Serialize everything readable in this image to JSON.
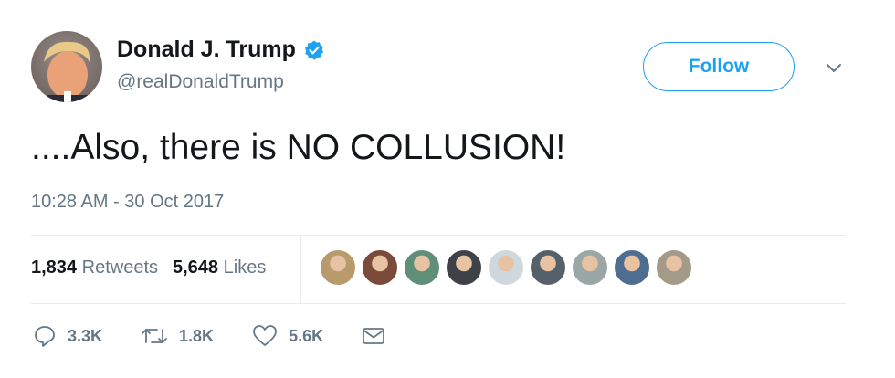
{
  "author": {
    "name": "Donald J. Trump",
    "handle": "@realDonaldTrump",
    "verified": true,
    "avatar_icon": "avatar-portrait"
  },
  "follow_label": "Follow",
  "tweet_text": "....Also, there is NO COLLUSION!",
  "timestamp": "10:28 AM - 30 Oct 2017",
  "stats": {
    "retweets_count": "1,834",
    "retweets_label": "Retweets",
    "likes_count": "5,648",
    "likes_label": "Likes"
  },
  "liker_avatars": [
    {
      "icon": "liker-avatar",
      "color": "#b89a6c"
    },
    {
      "icon": "liker-avatar",
      "color": "#7a4a3a"
    },
    {
      "icon": "liker-avatar",
      "color": "#5f8f78"
    },
    {
      "icon": "liker-avatar",
      "color": "#3e4248"
    },
    {
      "icon": "liker-avatar",
      "color": "#cfd8dc"
    },
    {
      "icon": "liker-avatar",
      "color": "#55606a"
    },
    {
      "icon": "liker-avatar",
      "color": "#9aa7a4"
    },
    {
      "icon": "liker-avatar",
      "color": "#4f6e8f"
    },
    {
      "icon": "liker-avatar",
      "color": "#a49a88"
    }
  ],
  "actions": {
    "replies": "3.3K",
    "retweets": "1.8K",
    "likes": "5.6K"
  },
  "colors": {
    "accent": "#1da1f2",
    "muted": "#657786",
    "text": "#14171a",
    "divider": "#e6ecf0"
  }
}
